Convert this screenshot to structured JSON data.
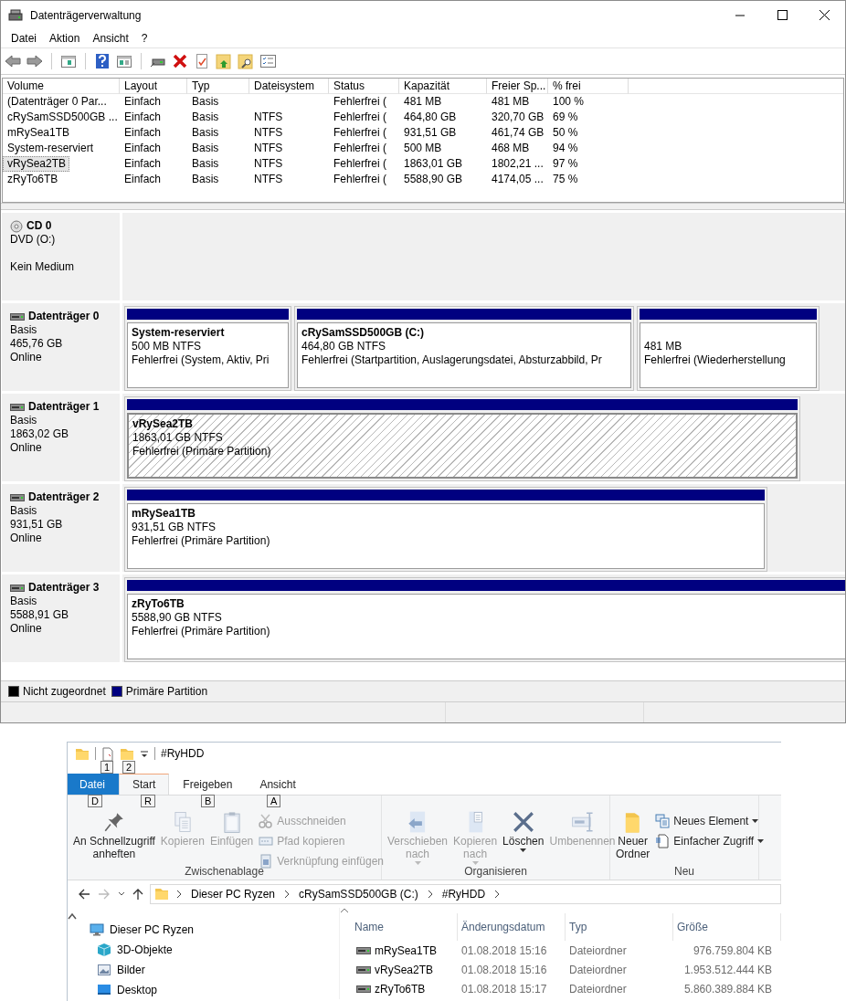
{
  "window": {
    "title": "Datenträgerverwaltung"
  },
  "menu": [
    "Datei",
    "Aktion",
    "Ansicht",
    "?"
  ],
  "volumes": {
    "columns": [
      "Volume",
      "Layout",
      "Typ",
      "Dateisystem",
      "Status",
      "Kapazität",
      "Freier Sp...",
      "% frei"
    ],
    "rows": [
      {
        "cells": [
          "(Datenträger 0 Par...",
          "Einfach",
          "Basis",
          "",
          "Fehlerfrei (",
          "481 MB",
          "481 MB",
          "100 %"
        ],
        "selected": false
      },
      {
        "cells": [
          "cRySamSSD500GB ...",
          "Einfach",
          "Basis",
          "NTFS",
          "Fehlerfrei (",
          "464,80 GB",
          "320,70 GB",
          "69 %"
        ],
        "selected": false
      },
      {
        "cells": [
          "mRySea1TB",
          "Einfach",
          "Basis",
          "NTFS",
          "Fehlerfrei (",
          "931,51 GB",
          "461,74 GB",
          "50 %"
        ],
        "selected": false
      },
      {
        "cells": [
          "System-reserviert",
          "Einfach",
          "Basis",
          "NTFS",
          "Fehlerfrei (",
          "500 MB",
          "468 MB",
          "94 %"
        ],
        "selected": false
      },
      {
        "cells": [
          "vRySea2TB",
          "Einfach",
          "Basis",
          "NTFS",
          "Fehlerfrei (",
          "1863,01 GB",
          "1802,21 ...",
          "97 %"
        ],
        "selected": true
      },
      {
        "cells": [
          "zRyTo6TB",
          "Einfach",
          "Basis",
          "NTFS",
          "Fehlerfrei (",
          "5588,90 GB",
          "4174,05 ...",
          "75 %"
        ],
        "selected": false
      }
    ]
  },
  "disks": [
    {
      "kind": "cd",
      "name": "CD 0",
      "type": "DVD (O:)",
      "status": "Kein Medium"
    },
    {
      "kind": "disk",
      "name": "Datenträger 0",
      "type": "Basis",
      "size": "465,76 GB",
      "status": "Online",
      "partitions": [
        {
          "name": "System-reserviert",
          "info": "500 MB NTFS",
          "status": "Fehlerfrei (System, Aktiv, Pri",
          "selected": false
        },
        {
          "name": "cRySamSSD500GB  (C:)",
          "info": "464,80 GB NTFS",
          "status": "Fehlerfrei (Startpartition, Auslagerungsdatei, Absturzabbild, Pr",
          "selected": false
        },
        {
          "info": "481 MB",
          "status": "Fehlerfrei (Wiederherstellung",
          "selected": false
        }
      ]
    },
    {
      "kind": "disk",
      "name": "Datenträger 1",
      "type": "Basis",
      "size": "1863,02 GB",
      "status": "Online",
      "partitions": [
        {
          "name": "vRySea2TB",
          "info": "1863,01 GB NTFS",
          "status": "Fehlerfrei (Primäre Partition)",
          "selected": true
        }
      ]
    },
    {
      "kind": "disk",
      "name": "Datenträger 2",
      "type": "Basis",
      "size": "931,51 GB",
      "status": "Online",
      "partitions": [
        {
          "name": "mRySea1TB",
          "info": "931,51 GB NTFS",
          "status": "Fehlerfrei (Primäre Partition)",
          "selected": false
        }
      ]
    },
    {
      "kind": "disk",
      "name": "Datenträger 3",
      "type": "Basis",
      "size": "5588,91 GB",
      "status": "Online",
      "partitions": [
        {
          "name": "zRyTo6TB",
          "info": "5588,90 GB NTFS",
          "status": "Fehlerfrei (Primäre Partition)",
          "selected": false
        }
      ]
    }
  ],
  "legend": [
    {
      "label": "Nicht zugeordnet",
      "color": "#000000"
    },
    {
      "label": "Primäre Partition",
      "color": "#000080"
    }
  ],
  "explorer": {
    "title": "#RyHDD",
    "quick_keytips": [
      "1",
      "2"
    ],
    "tabs": [
      {
        "label": "Datei",
        "keytip": "D",
        "kind": "file",
        "selected": false
      },
      {
        "label": "Start",
        "keytip": "R",
        "kind": "tab",
        "selected": true
      },
      {
        "label": "Freigeben",
        "keytip": "B",
        "kind": "tab",
        "selected": false
      },
      {
        "label": "Ansicht",
        "keytip": "A",
        "kind": "tab",
        "selected": false
      }
    ],
    "ribbon_groups": [
      {
        "label": "Zwischenablage",
        "buttons": [
          {
            "kind": "large",
            "label": "An Schnellzugriff\nanheften",
            "disabled": false
          },
          {
            "kind": "large",
            "label": "Kopieren",
            "disabled": true
          },
          {
            "kind": "large",
            "label": "Einfügen",
            "disabled": true
          },
          {
            "kind": "small",
            "label": "Ausschneiden",
            "disabled": true
          },
          {
            "kind": "small",
            "label": "Pfad kopieren",
            "disabled": true
          },
          {
            "kind": "small",
            "label": "Verknüpfung einfügen",
            "disabled": true
          }
        ]
      },
      {
        "label": "Organisieren",
        "buttons": [
          {
            "kind": "large",
            "label": "Verschieben\nnach",
            "dropdown": true,
            "disabled": true
          },
          {
            "kind": "large",
            "label": "Kopieren\nnach",
            "dropdown": true,
            "disabled": true
          },
          {
            "kind": "large",
            "label": "Löschen",
            "dropdown": true,
            "disabled": false
          },
          {
            "kind": "large",
            "label": "Umbenennen",
            "disabled": true
          }
        ]
      },
      {
        "label": "Neu",
        "buttons": [
          {
            "kind": "large",
            "label": "Neuer\nOrdner",
            "disabled": false
          },
          {
            "kind": "small",
            "label": "Neues Element",
            "dropdown": true,
            "disabled": false
          },
          {
            "kind": "small",
            "label": "Einfacher Zugriff",
            "dropdown": true,
            "disabled": false
          }
        ]
      }
    ],
    "address": [
      "Dieser PC Ryzen",
      "cRySamSSD500GB (C:)",
      "#RyHDD"
    ],
    "nav": [
      {
        "label": "Dieser PC Ryzen",
        "children": [
          {
            "label": "3D-Objekte"
          },
          {
            "label": "Bilder"
          },
          {
            "label": "Desktop"
          }
        ]
      }
    ],
    "files": {
      "columns": [
        "Name",
        "Änderungsdatum",
        "Typ",
        "Größe"
      ],
      "rows": [
        [
          "mRySea1TB",
          "01.08.2018 15:16",
          "Dateiordner",
          "976.759.804 KB"
        ],
        [
          "vRySea2TB",
          "01.08.2018 15:16",
          "Dateiordner",
          "1.953.512.444 KB"
        ],
        [
          "zRyTo6TB",
          "01.08.2018 15:17",
          "Dateiordner",
          "5.860.389.884 KB"
        ]
      ]
    }
  }
}
